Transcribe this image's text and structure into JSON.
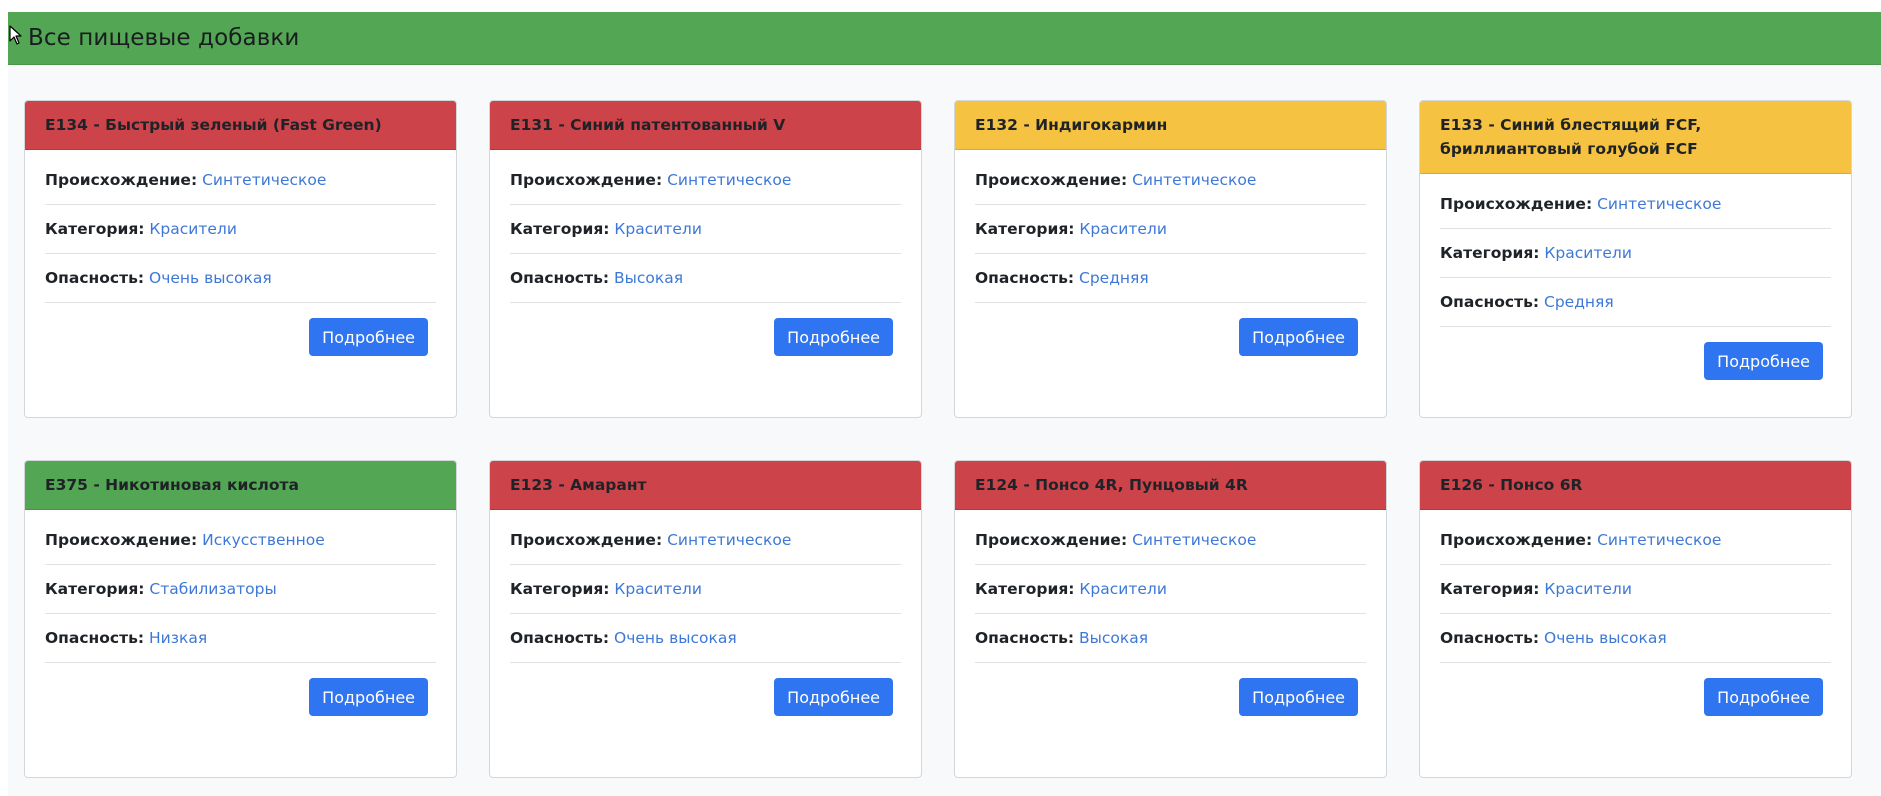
{
  "page_title": "Все пищевые добавки",
  "labels": {
    "origin": "Происхождение:",
    "category": "Категория:",
    "danger": "Опасность:",
    "details_button": "Подробнее"
  },
  "cards": [
    {
      "title": "E134 - Быстрый зеленый (Fast Green)",
      "color": "#cc434a",
      "origin": "Синтетическое",
      "category": "Красители",
      "danger": "Очень высокая"
    },
    {
      "title": "E131 - Синий патентованный V",
      "color": "#cc434a",
      "origin": "Синтетическое",
      "category": "Красители",
      "danger": "Высокая"
    },
    {
      "title": "E132 - Индигокармин",
      "color": "#f5c242",
      "origin": "Синтетическое",
      "category": "Красители",
      "danger": "Средняя"
    },
    {
      "title": "E133 - Синий блестящий FCF, бриллиантовый голубой FCF",
      "color": "#f5c242",
      "origin": "Синтетическое",
      "category": "Красители",
      "danger": "Средняя"
    },
    {
      "title": "E375 - Никотиновая кислота",
      "color": "#53a653",
      "origin": "Искусственное",
      "category": "Стабилизаторы",
      "danger": "Низкая"
    },
    {
      "title": "E123 - Амарант",
      "color": "#cc434a",
      "origin": "Синтетическое",
      "category": "Красители",
      "danger": "Очень высокая"
    },
    {
      "title": "E124 - Понсо 4R, Пунцовый 4R",
      "color": "#cc434a",
      "origin": "Синтетическое",
      "category": "Красители",
      "danger": "Высокая"
    },
    {
      "title": "E126 - Понсо 6R",
      "color": "#cc434a",
      "origin": "Синтетическое",
      "category": "Красители",
      "danger": "Очень высокая"
    }
  ],
  "colors": {
    "header_bg": "#53a653",
    "danger_high": "#cc434a",
    "danger_medium": "#f5c242",
    "danger_low": "#53a653",
    "button": "#2f74f0",
    "link_value": "#3d78d8"
  }
}
